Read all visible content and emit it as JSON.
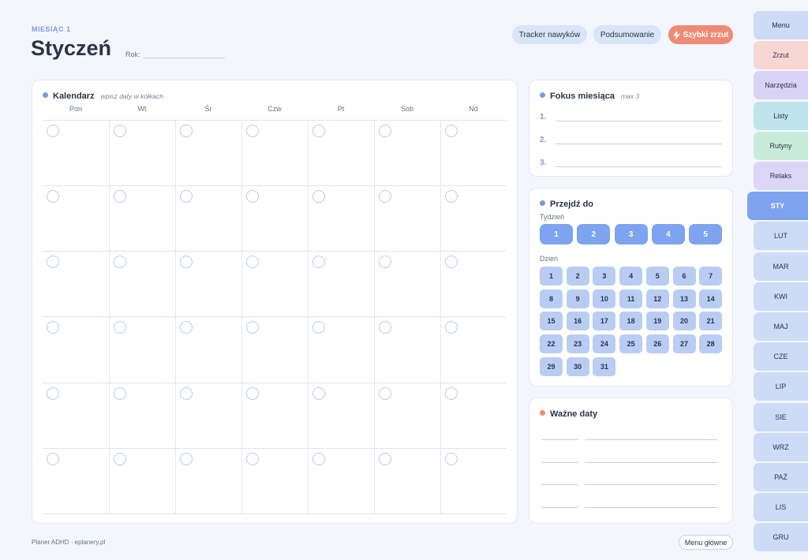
{
  "header": {
    "eyebrow": "MIESIĄC 1",
    "title": "Styczeń",
    "year_label": "Rok:"
  },
  "top_actions": {
    "habit_tracker": "Tracker nawyków",
    "summary": "Podsumowanie",
    "quick_dump": "Szybki zrzut"
  },
  "calendar": {
    "title": "Kalendarz",
    "hint": "wpisz daty w kółkach",
    "weekdays": [
      "Pon",
      "Wt",
      "Śr",
      "Czw",
      "Pt",
      "Sob",
      "Nd"
    ]
  },
  "focus": {
    "title": "Fokus miesiąca",
    "hint": "max 3",
    "items": [
      "1.",
      "2.",
      "3."
    ]
  },
  "goto": {
    "title": "Przejdź do",
    "week_label": "Tydzień",
    "weeks": [
      "1",
      "2",
      "3",
      "4",
      "5"
    ],
    "day_label": "Dzień",
    "days": [
      "1",
      "2",
      "3",
      "4",
      "5",
      "6",
      "7",
      "8",
      "9",
      "10",
      "11",
      "12",
      "13",
      "14",
      "15",
      "16",
      "17",
      "18",
      "19",
      "20",
      "21",
      "22",
      "23",
      "24",
      "25",
      "26",
      "27",
      "28",
      "29",
      "30",
      "31"
    ]
  },
  "important_dates": {
    "title": "Ważne daty"
  },
  "footer": {
    "text": "Planer ADHD · eplanery.pl",
    "main_menu": "Menu główne"
  },
  "sidebar": {
    "sections": [
      {
        "label": "Menu",
        "color": "#cddbf6"
      },
      {
        "label": "Zrzut",
        "color": "#f8d6d2"
      },
      {
        "label": "Narzędzia",
        "color": "#d9d3f5"
      },
      {
        "label": "Listy",
        "color": "#bfe4ee"
      },
      {
        "label": "Rutyny",
        "color": "#c8ecd9"
      },
      {
        "label": "Relaks",
        "color": "#dcd6f6"
      }
    ],
    "months": [
      "STY",
      "LUT",
      "MAR",
      "KWI",
      "MAJ",
      "CZE",
      "LIP",
      "SIE",
      "WRZ",
      "PAŹ",
      "LIS",
      "GRU"
    ],
    "active_month": "STY"
  }
}
